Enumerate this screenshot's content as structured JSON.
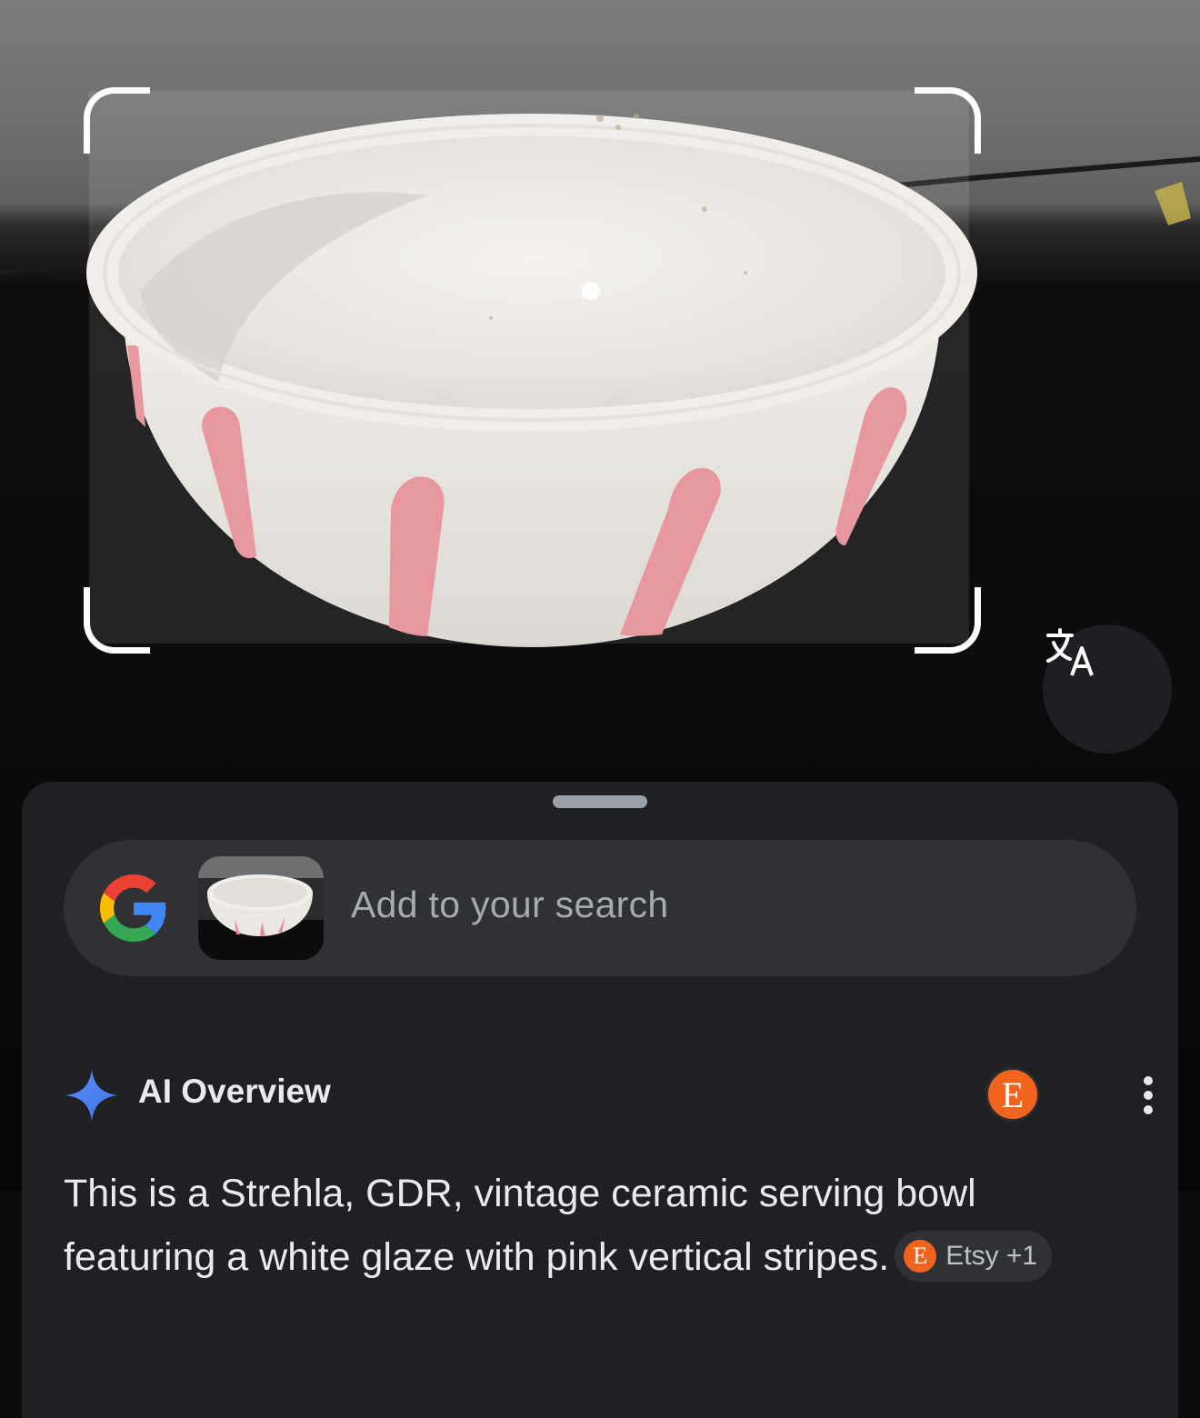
{
  "viewfinder": {
    "translate_icon": "translate-icon"
  },
  "search": {
    "placeholder": "Add to your search",
    "logo_icon": "google-g-icon",
    "thumbnail": "bowl-thumbnail"
  },
  "ai_overview": {
    "title": "AI Overview",
    "icon": "sparkle-icon",
    "source_avatar_letter": "E",
    "source_avatar_color": "#f1641e",
    "menu_icon": "more-vert-icon",
    "text": "This is a Strehla, GDR, vintage ceramic serving bowl featuring a white glaze with pink vertical stripes.",
    "chip": {
      "icon_letter": "E",
      "label": "Etsy +1"
    }
  },
  "colors": {
    "sheet_bg": "#1f2024",
    "search_bg": "#303134",
    "accent_blue": "#4f8ef7",
    "etsy_orange": "#f1641e",
    "stripe_pink": "#e58d95"
  }
}
